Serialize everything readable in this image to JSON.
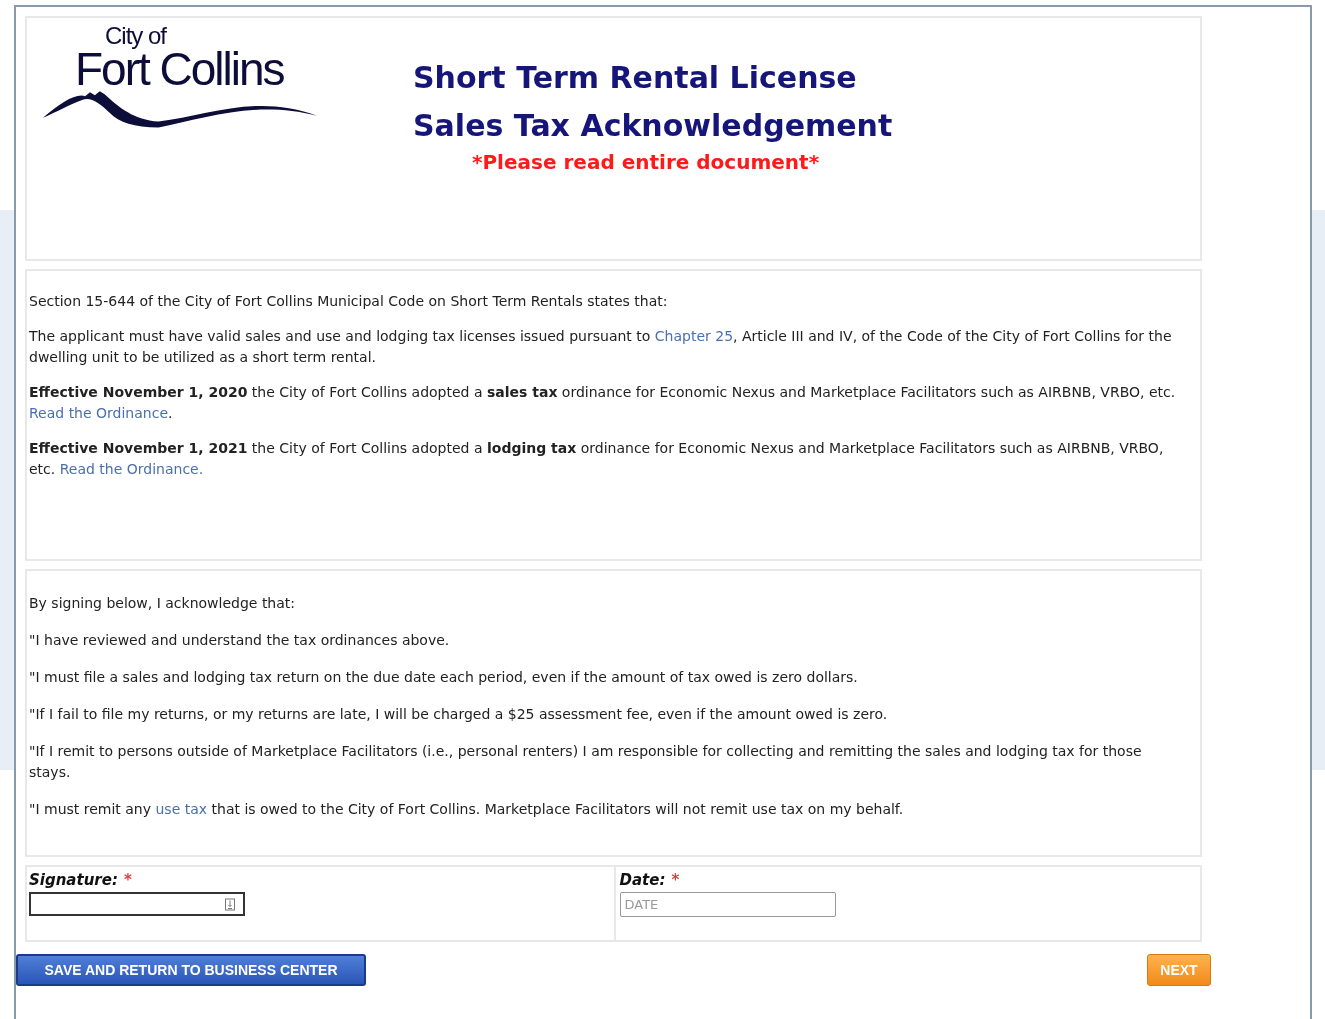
{
  "logo": {
    "line_1": "City of",
    "line_2": "Fort Collins"
  },
  "header": {
    "title_1": "Short Term Rental License",
    "title_2": "Sales Tax Acknowledgement",
    "notice": "*Please read entire document*"
  },
  "ordinance_section": {
    "paragraphs": [
      [
        {
          "kind": "text",
          "text": "Section 15-644 of the City of Fort Collins Municipal Code on Short Term Rentals states that:"
        }
      ],
      [
        {
          "kind": "text",
          "text": "The applicant must have valid sales and use and lodging tax licenses issued pursuant to "
        },
        {
          "kind": "link",
          "text": "Chapter 25"
        },
        {
          "kind": "text",
          "text": ", Article III and IV, of the Code of the City of Fort Collins for the dwelling unit to be utilized as a short term rental."
        }
      ],
      [
        {
          "kind": "text",
          "text": "**Effective November 1, 2020** the City of Fort Collins adopted a **sales tax** ordinance for Economic Nexus and Marketplace Facilitators such as AIRBNB, VRBO, etc. "
        },
        {
          "kind": "link",
          "text": "Read the Ordinance"
        },
        {
          "kind": "text",
          "text": "."
        }
      ],
      [
        {
          "kind": "text",
          "text": "**Effective November 1, 2021** the City of Fort Collins adopted a **lodging tax** ordinance for Economic Nexus and Marketplace Facilitators such as AIRBNB, VRBO, etc. "
        },
        {
          "kind": "link",
          "text": "Read the Ordinance."
        }
      ]
    ]
  },
  "acknowledgement_section": {
    "paragraphs": [
      [
        {
          "kind": "text",
          "text": "By signing below, I acknowledge that:"
        }
      ],
      [
        {
          "kind": "text",
          "text": "\"I have reviewed and understand the tax ordinances above."
        }
      ],
      [
        {
          "kind": "text",
          "text": "\"I must file a sales and lodging tax return on the due date each period, even if the amount of tax owed is zero dollars."
        }
      ],
      [
        {
          "kind": "text",
          "text": "\"If I fail to file my returns, or my returns are late, I will be charged a $25 assessment fee, even if the amount owed is zero."
        }
      ],
      [
        {
          "kind": "text",
          "text": "\"If I remit to persons outside of Marketplace Facilitators (i.e., personal renters) I am responsible for collecting and remitting the sales and lodging tax for those stays."
        }
      ],
      [
        {
          "kind": "text",
          "text": "\"I must remit any "
        },
        {
          "kind": "link",
          "text": "use tax"
        },
        {
          "kind": "text",
          "text": " that is owed to the City of Fort Collins. Marketplace Facilitators will not remit use tax on my behalf."
        }
      ]
    ]
  },
  "form": {
    "fields": [
      {
        "kind": "signature",
        "label": "Signature:",
        "required_mark": "*"
      },
      {
        "kind": "date",
        "label": "Date:",
        "required_mark": "*",
        "placeholder": "DATE"
      }
    ]
  },
  "buttons": {
    "save": "SAVE AND RETURN TO BUSINESS CENTER",
    "next": "NEXT"
  }
}
